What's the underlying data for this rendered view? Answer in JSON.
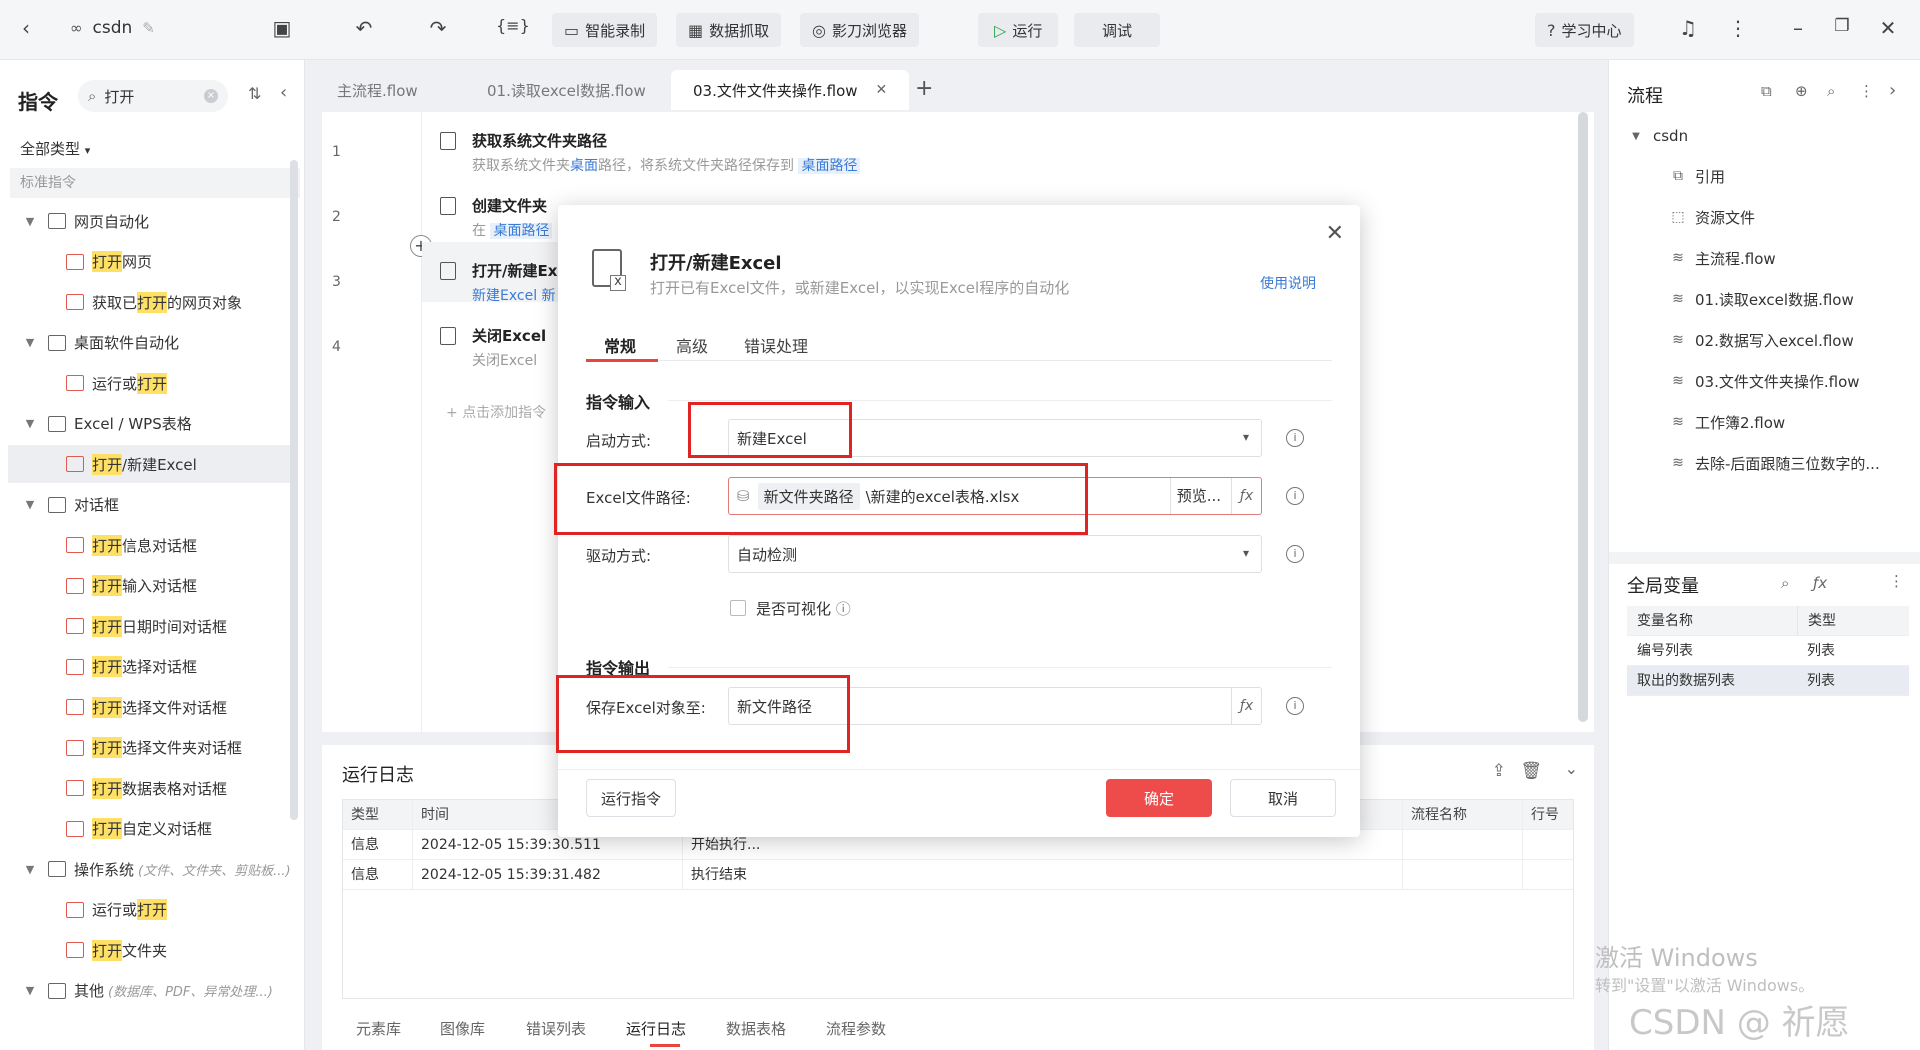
{
  "titlebar": {
    "back": "‹",
    "project": "csdn",
    "smart_record": "智能录制",
    "data_capture": "数据抓取",
    "browser": "影刀浏览器",
    "run": "运行",
    "debug": "调试",
    "learn": "学习中心"
  },
  "left": {
    "title": "指令",
    "search_value": "打开",
    "filter": "全部类型",
    "section": "标准指令",
    "tree": [
      {
        "kind": "group",
        "label": "网页自动化"
      },
      {
        "kind": "item",
        "pre": "",
        "hl": "打开",
        "post": "网页"
      },
      {
        "kind": "item",
        "pre": "获取已",
        "hl": "打开",
        "post": "的网页对象"
      },
      {
        "kind": "group",
        "label": "桌面软件自动化"
      },
      {
        "kind": "item",
        "pre": "运行或",
        "hl": "打开",
        "post": ""
      },
      {
        "kind": "group",
        "label": "Excel / WPS表格"
      },
      {
        "kind": "item",
        "pre": "",
        "hl": "打开",
        "post": "/新建Excel"
      },
      {
        "kind": "group",
        "label": "对话框"
      },
      {
        "kind": "item",
        "pre": "",
        "hl": "打开",
        "post": "信息对话框"
      },
      {
        "kind": "item",
        "pre": "",
        "hl": "打开",
        "post": "输入对话框"
      },
      {
        "kind": "item",
        "pre": "",
        "hl": "打开",
        "post": "日期时间对话框"
      },
      {
        "kind": "item",
        "pre": "",
        "hl": "打开",
        "post": "选择对话框"
      },
      {
        "kind": "item",
        "pre": "",
        "hl": "打开",
        "post": "选择文件对话框"
      },
      {
        "kind": "item",
        "pre": "",
        "hl": "打开",
        "post": "选择文件夹对话框"
      },
      {
        "kind": "item",
        "pre": "",
        "hl": "打开",
        "post": "数据表格对话框"
      },
      {
        "kind": "item",
        "pre": "",
        "hl": "打开",
        "post": "自定义对话框"
      },
      {
        "kind": "group",
        "label": "操作系统",
        "sub": "(文件、文件夹、剪贴板...)"
      },
      {
        "kind": "item",
        "pre": "运行或",
        "hl": "打开",
        "post": ""
      },
      {
        "kind": "item",
        "pre": "",
        "hl": "打开",
        "post": "文件夹"
      },
      {
        "kind": "group",
        "label": "其他",
        "sub": "(数据库、PDF、异常处理...)"
      }
    ]
  },
  "tabs": [
    "主流程.flow",
    "01.读取excel数据.flow",
    "03.文件文件夹操作.flow"
  ],
  "editor": {
    "lines": [
      "1",
      "2",
      "3",
      "4"
    ],
    "steps": [
      {
        "title": "获取系统文件夹路径",
        "desc_a": "获取系统文件夹",
        "desc_link": "桌面",
        "desc_b": "路径，将系统文件夹路径保存到",
        "chip": "桌面路径"
      },
      {
        "title": "创建文件夹",
        "desc_a": "在",
        "chip": "桌面路径"
      },
      {
        "title": "打开/新建Ex",
        "desc_a": "新建Excel",
        "desc_b": "新"
      },
      {
        "title": "关闭Excel",
        "desc_a": "关闭Excel"
      }
    ],
    "add_hint": "点击添加指令"
  },
  "log": {
    "title": "运行日志",
    "headers": [
      "类型",
      "时间",
      "",
      "流程名称",
      "行号"
    ],
    "rows": [
      {
        "type": "信息",
        "time": "2024-12-05 15:39:30.511",
        "msg": "开始执行..."
      },
      {
        "type": "信息",
        "time": "2024-12-05 15:39:31.482",
        "msg": "执行结束"
      }
    ],
    "tabs": [
      "元素库",
      "图像库",
      "错误列表",
      "运行日志",
      "数据表格",
      "流程参数"
    ]
  },
  "right": {
    "title": "流程",
    "root": "csdn",
    "items": [
      "引用",
      "资源文件",
      "主流程.flow",
      "01.读取excel数据.flow",
      "02.数据写入excel.flow",
      "03.文件文件夹操作.flow",
      "工作簿2.flow",
      "去除-后面跟随三位数字的..."
    ],
    "vars_title": "全局变量",
    "var_headers": [
      "变量名称",
      "类型"
    ],
    "vars": [
      {
        "name": "编号列表",
        "type": "列表"
      },
      {
        "name": "取出的数据列表",
        "type": "列表"
      }
    ],
    "watermark1": "激活 Windows",
    "watermark2": "转到\"设置\"以激活 Windows。",
    "watermark3": "CSDN @ 祈愿"
  },
  "dialog": {
    "title": "打开/新建Excel",
    "subtitle": "打开已有Excel文件，或新建Excel，以实现Excel程序的自动化",
    "help": "使用说明",
    "tabs": [
      "常规",
      "高级",
      "错误处理"
    ],
    "section_input": "指令输入",
    "launch_label": "启动方式:",
    "launch_value": "新建Excel",
    "path_label": "Excel文件路径:",
    "path_chip": "新文件夹路径",
    "path_text": "\\新建的excel表格.xlsx",
    "browse": "预览...",
    "driver_label": "驱动方式:",
    "driver_value": "自动检测",
    "visible_label": "是否可视化",
    "section_output": "指令输出",
    "save_label": "保存Excel对象至:",
    "save_value": "新文件路径",
    "run_btn": "运行指令",
    "ok_btn": "确定",
    "cancel_btn": "取消"
  },
  "colors": {
    "accent": "#ee4b4b",
    "link": "#3a7bd5",
    "highlight": "#ffe066",
    "annotation": "#e02424"
  }
}
